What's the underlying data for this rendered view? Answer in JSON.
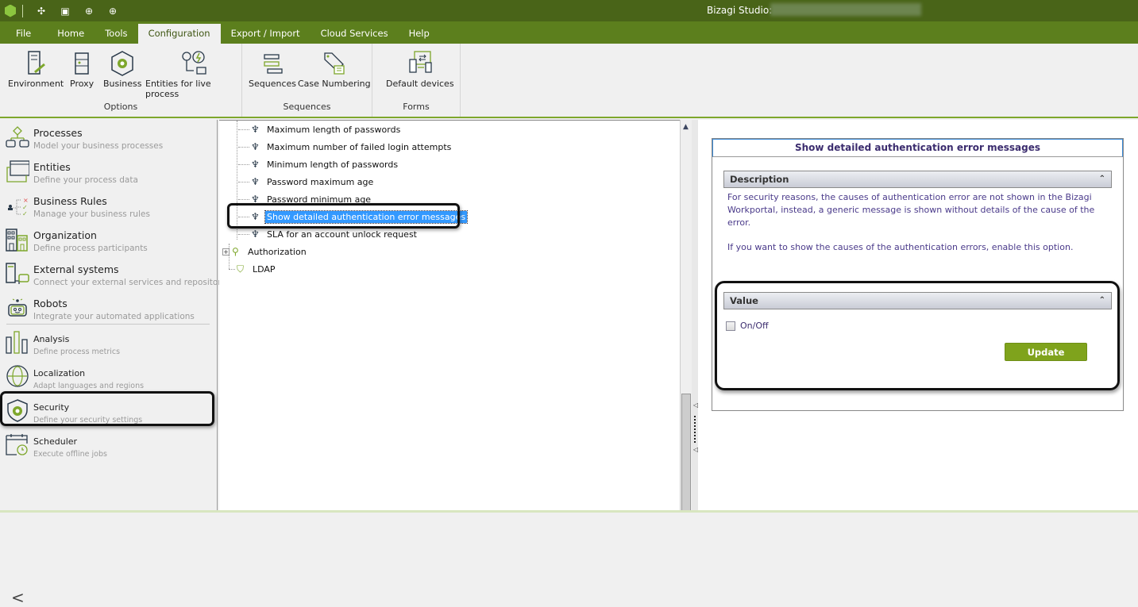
{
  "titlebar": {
    "app_title": "Bizagi Studio: ",
    "quick_icons": [
      "process-wizard-icon",
      "layout-icon",
      "download-icon",
      "upload-icon"
    ]
  },
  "menu": {
    "items": [
      "File",
      "Home",
      "Tools",
      "Configuration",
      "Export / Import",
      "Cloud Services",
      "Help"
    ],
    "active": "Configuration"
  },
  "ribbon": {
    "groups": [
      {
        "label": "Options",
        "buttons": [
          "Environment",
          "Proxy",
          "Business",
          "Entities for live process"
        ]
      },
      {
        "label": "Sequences",
        "buttons": [
          "Sequences",
          "Case Numbering"
        ]
      },
      {
        "label": "Forms",
        "buttons": [
          "Default devices"
        ]
      }
    ]
  },
  "sidebar": {
    "items": [
      {
        "title": "Processes",
        "desc": "Model your business processes"
      },
      {
        "title": "Entities",
        "desc": "Define your process data"
      },
      {
        "title": "Business Rules",
        "desc": "Manage your business rules"
      },
      {
        "title": "Organization",
        "desc": "Define process participants"
      },
      {
        "title": "External systems",
        "desc": "Connect your external services and repositories"
      },
      {
        "title": "Robots",
        "desc": "Integrate your automated applications"
      },
      {
        "title": "Analysis",
        "desc": "Define process metrics"
      },
      {
        "title": "Localization",
        "desc": "Adapt languages and regions"
      },
      {
        "title": "Security",
        "desc": "Define your security settings"
      },
      {
        "title": "Scheduler",
        "desc": "Execute offline jobs"
      }
    ],
    "active": "Security",
    "collapse_glyph": "<"
  },
  "tree": {
    "items": [
      "Maximum length of passwords",
      "Maximum number of failed login attempts",
      "Minimum length of passwords",
      "Password maximum age",
      "Password minimum age",
      "Show detailed authentication error messages",
      "SLA for an account unlock request"
    ],
    "selected": "Show detailed authentication error messages",
    "authorization": "Authorization",
    "ldap": "LDAP"
  },
  "detail": {
    "title": "Show detailed authentication error messages",
    "description_header": "Description",
    "description_p1": "For security reasons, the causes of authentication error are not shown in the Bizagi Workportal, instead, a generic message is shown without details of the cause of the error.",
    "description_p2": "If you want to show the causes of the authentication errors, enable this option.",
    "value_header": "Value",
    "checkbox_label": "On/Off",
    "checkbox_checked": false,
    "update_label": "Update"
  }
}
